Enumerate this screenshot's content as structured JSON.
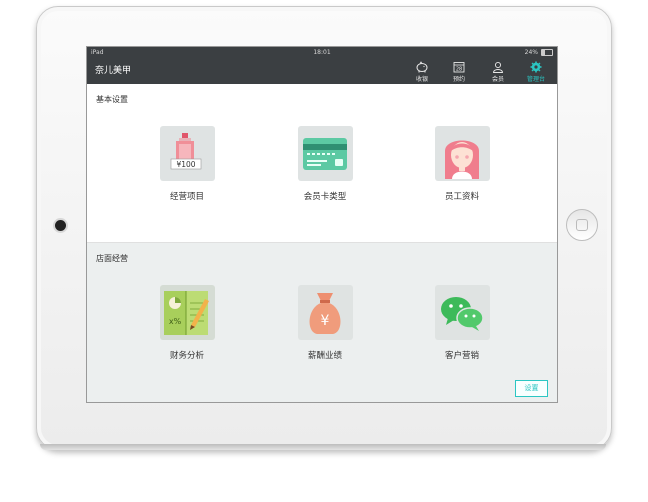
{
  "status_bar": {
    "device": "iPad",
    "time": "18:01",
    "battery": "24%"
  },
  "nav": {
    "title": "奈儿美甲",
    "items": [
      {
        "label": "收银",
        "icon": "piggy-bank-icon"
      },
      {
        "label": "预约",
        "icon": "calendar-icon",
        "date": "28"
      },
      {
        "label": "会员",
        "icon": "user-icon"
      },
      {
        "label": "管理台",
        "icon": "gear-icon",
        "active": true
      }
    ]
  },
  "sections": [
    {
      "title": "基本设置",
      "tiles": [
        {
          "label": "经营项目",
          "icon": "perfume-price-icon",
          "price": "¥100"
        },
        {
          "label": "会员卡类型",
          "icon": "member-card-icon"
        },
        {
          "label": "员工资料",
          "icon": "staff-avatar-icon"
        }
      ]
    },
    {
      "title": "店面经营",
      "tiles": [
        {
          "label": "财务分析",
          "icon": "finance-notebook-icon",
          "glyph": "x%"
        },
        {
          "label": "薪酬业绩",
          "icon": "money-bag-icon",
          "glyph": "¥"
        },
        {
          "label": "客户营销",
          "icon": "wechat-icon"
        }
      ]
    }
  ],
  "settings_button": "设置",
  "colors": {
    "accent": "#2bc6c3",
    "nav_bg": "#3b3f42",
    "section2_bg": "#ecefef"
  }
}
